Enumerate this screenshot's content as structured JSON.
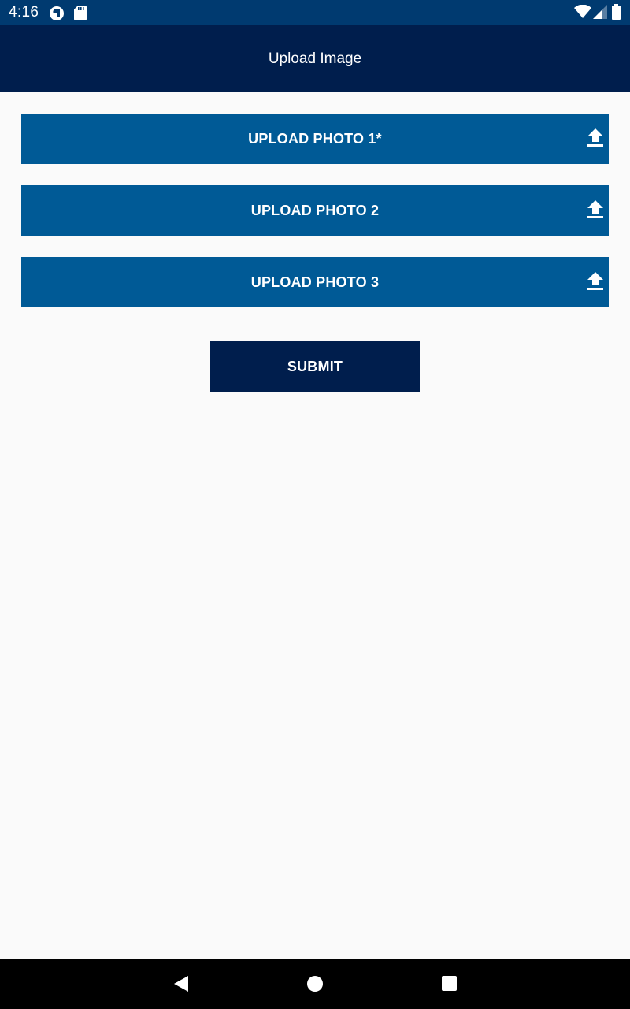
{
  "status_bar": {
    "time": "4:16",
    "background": "#003a70"
  },
  "app_bar": {
    "title": "Upload Image",
    "background": "#001e4d"
  },
  "upload_buttons": [
    {
      "label": "UPLOAD PHOTO 1*",
      "icon": "upload-icon"
    },
    {
      "label": "UPLOAD PHOTO 2",
      "icon": "upload-icon"
    },
    {
      "label": "UPLOAD PHOTO 3",
      "icon": "upload-icon"
    }
  ],
  "submit": {
    "label": "SUBMIT"
  },
  "colors": {
    "upload_button": "#005a96",
    "submit_button": "#001e4d",
    "page_background": "#fafafa",
    "nav_bar": "#000000"
  },
  "nav_bar": {
    "icons": [
      "back-icon",
      "home-icon",
      "recents-icon"
    ]
  }
}
